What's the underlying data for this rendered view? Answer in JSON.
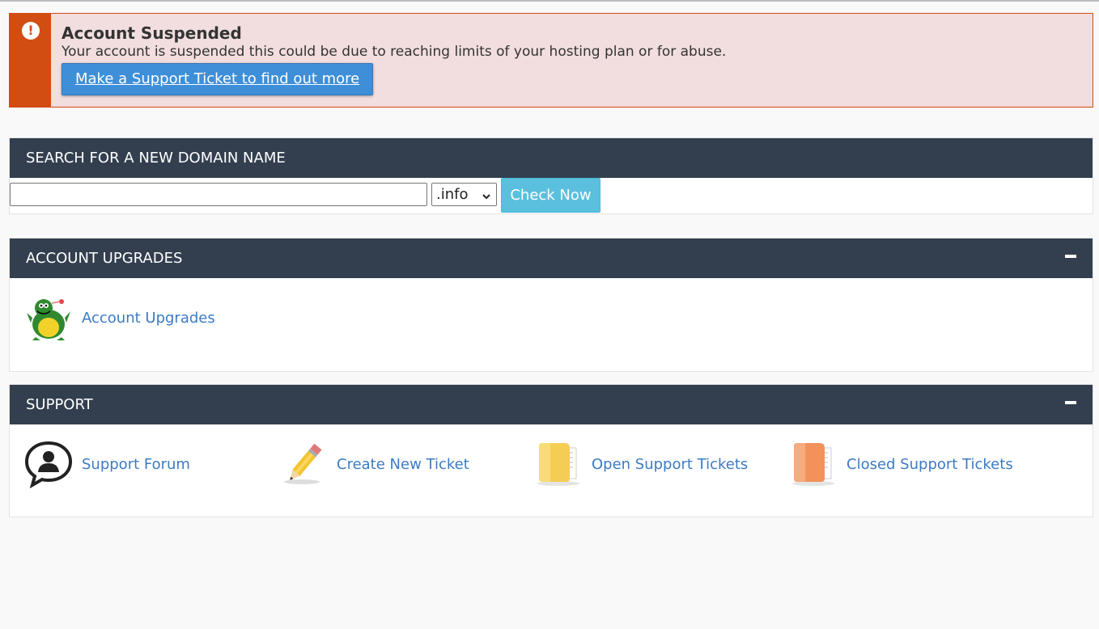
{
  "alert": {
    "title": "Account Suspended",
    "message": "Your account is suspended this could be due to reaching limits of your hosting plan or for abuse.",
    "button_label": "Make a Support Ticket to find out more",
    "icon": "exclamation-icon",
    "accent_color": "#d24d11",
    "background_color": "#f2dede"
  },
  "domain_search": {
    "title": "SEARCH FOR A NEW DOMAIN NAME",
    "input_value": "",
    "tld_selected": ".info",
    "check_button_label": "Check Now"
  },
  "upgrades": {
    "title": "ACCOUNT UPGRADES",
    "items": [
      {
        "label": "Account Upgrades",
        "icon": "dragon-mascot-icon"
      }
    ]
  },
  "support": {
    "title": "SUPPORT",
    "items": [
      {
        "label": "Support Forum",
        "icon": "chat-bubble-user-icon"
      },
      {
        "label": "Create New Ticket",
        "icon": "pencil-icon"
      },
      {
        "label": "Open Support Tickets",
        "icon": "yellow-folder-icon"
      },
      {
        "label": "Closed Support Tickets",
        "icon": "orange-folder-icon"
      }
    ]
  },
  "colors": {
    "panel_header": "#333f4f",
    "link": "#3c7bc3",
    "primary_button": "#3e8fd8",
    "info_button": "#5bc0de"
  }
}
